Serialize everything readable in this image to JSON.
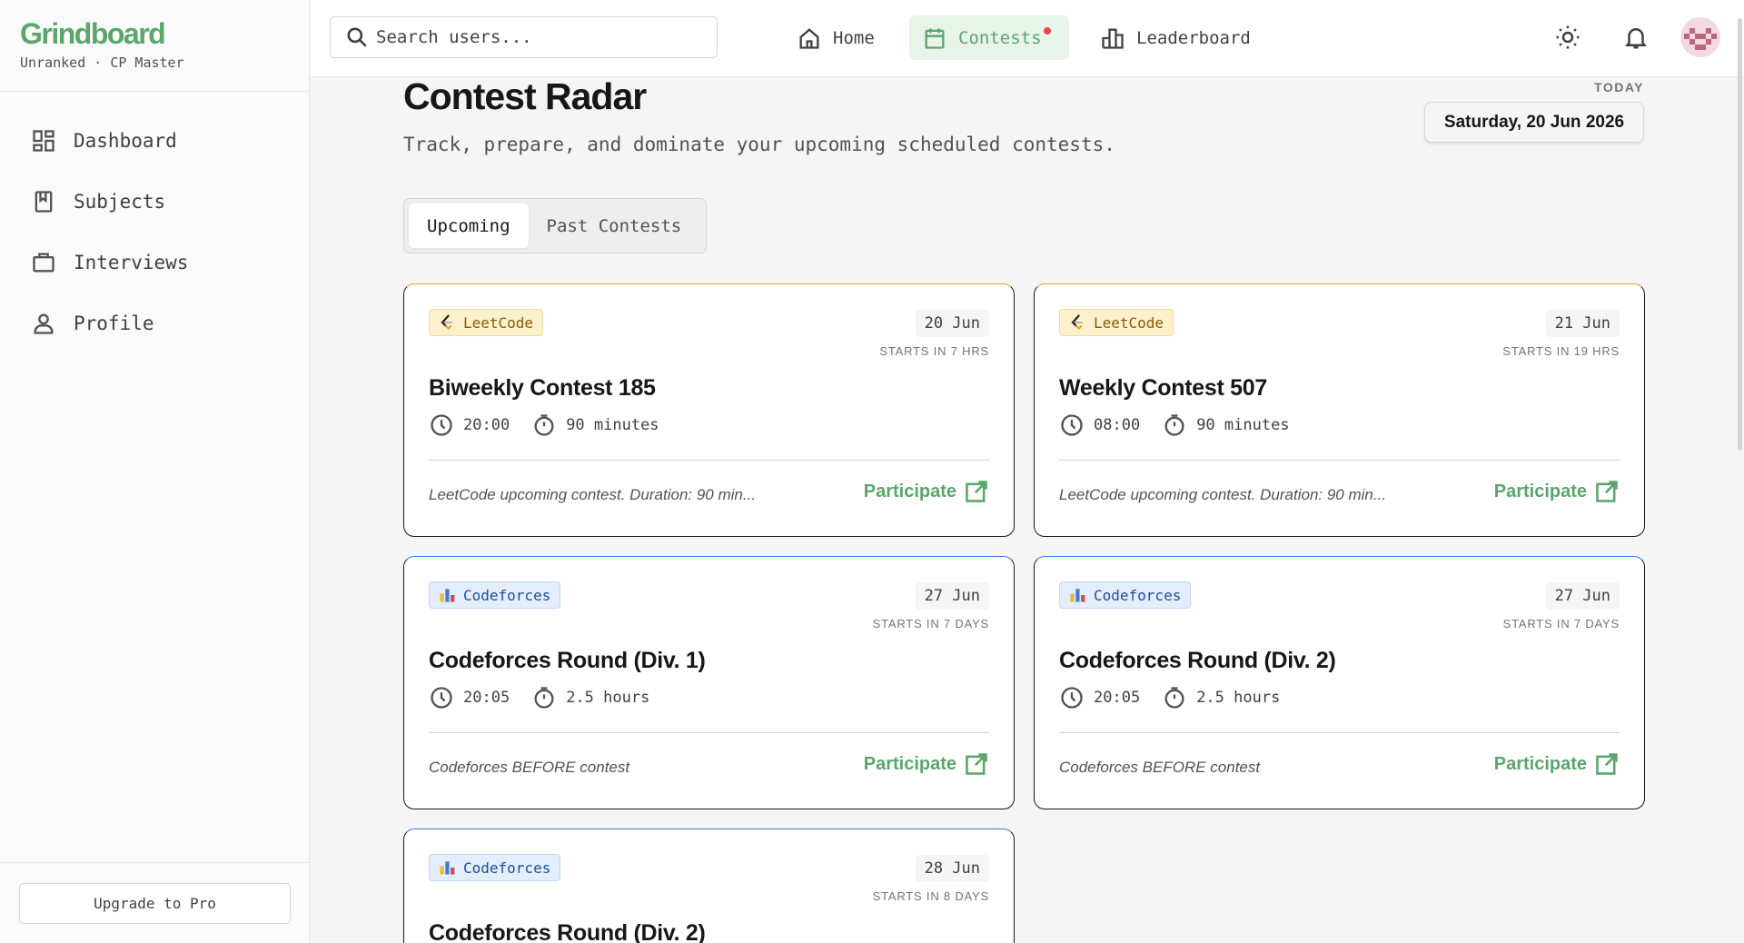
{
  "brand": {
    "title": "Grindboard",
    "subtitle": "Unranked · CP Master"
  },
  "sidebar": {
    "items": [
      {
        "label": "Dashboard",
        "icon": "dashboard-icon"
      },
      {
        "label": "Subjects",
        "icon": "book-icon"
      },
      {
        "label": "Interviews",
        "icon": "briefcase-icon"
      },
      {
        "label": "Profile",
        "icon": "user-icon"
      }
    ],
    "upgrade_label": "Upgrade to Pro"
  },
  "topbar": {
    "search_placeholder": "Search users...",
    "nav": [
      {
        "label": "Home",
        "icon": "home-icon",
        "active": false
      },
      {
        "label": "Contests",
        "icon": "calendar-icon",
        "active": true,
        "notification_dot": true
      },
      {
        "label": "Leaderboard",
        "icon": "leaderboard-icon",
        "active": false
      }
    ],
    "accent": "#5aa66c"
  },
  "page": {
    "title": "Contest Radar",
    "subtitle": "Track, prepare, and dominate your upcoming scheduled contests.",
    "today_label": "TODAY",
    "today_date": "Saturday, 20 Jun 2026"
  },
  "tabs": [
    {
      "label": "Upcoming",
      "active": true
    },
    {
      "label": "Past Contests",
      "active": false
    }
  ],
  "contests": [
    {
      "platform": "LeetCode",
      "date": "20 Jun",
      "starts": "STARTS IN 7 HRS",
      "title": "Biweekly Contest 185",
      "time": "20:00",
      "duration": "90 minutes",
      "description": "LeetCode upcoming contest. Duration: 90 min...",
      "action": "Participate"
    },
    {
      "platform": "LeetCode",
      "date": "21 Jun",
      "starts": "STARTS IN 19 HRS",
      "title": "Weekly Contest 507",
      "time": "08:00",
      "duration": "90 minutes",
      "description": "LeetCode upcoming contest. Duration: 90 min...",
      "action": "Participate"
    },
    {
      "platform": "Codeforces",
      "date": "27 Jun",
      "starts": "STARTS IN 7 DAYS",
      "title": "Codeforces Round (Div. 1)",
      "time": "20:05",
      "duration": "2.5 hours",
      "description": "Codeforces BEFORE contest",
      "action": "Participate"
    },
    {
      "platform": "Codeforces",
      "date": "27 Jun",
      "starts": "STARTS IN 7 DAYS",
      "title": "Codeforces Round (Div. 2)",
      "time": "20:05",
      "duration": "2.5 hours",
      "description": "Codeforces BEFORE contest",
      "action": "Participate"
    },
    {
      "platform": "Codeforces",
      "date": "28 Jun",
      "starts": "STARTS IN 8 DAYS",
      "title": "Codeforces Round (Div. 2)"
    }
  ],
  "colors": {
    "leetcode_border": "#e6a534",
    "codeforces_border": "#3b7bd8"
  }
}
